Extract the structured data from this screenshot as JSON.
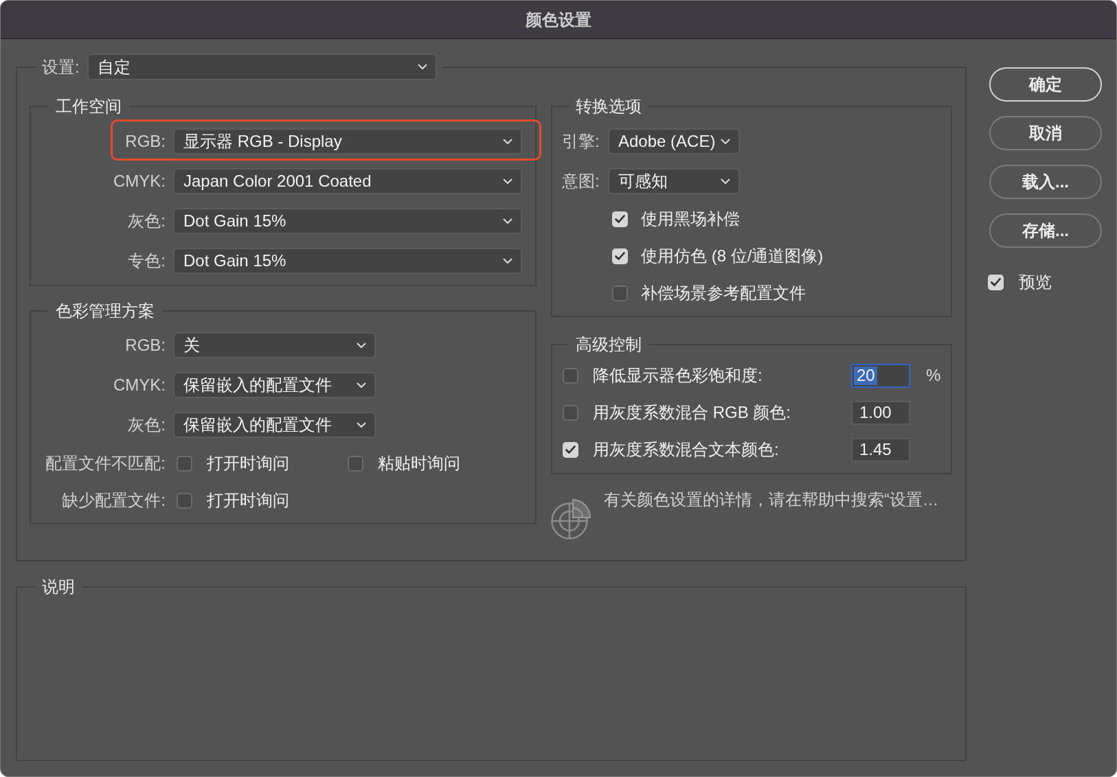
{
  "window": {
    "title": "颜色设置"
  },
  "settings": {
    "label": "设置:",
    "value": "自定"
  },
  "working_spaces": {
    "title": "工作空间",
    "rows": [
      {
        "label": "RGB:",
        "value": "显示器 RGB - Display",
        "highlighted": true
      },
      {
        "label": "CMYK:",
        "value": "Japan Color 2001 Coated",
        "highlighted": false
      },
      {
        "label": "灰色:",
        "value": "Dot Gain 15%",
        "highlighted": false
      },
      {
        "label": "专色:",
        "value": "Dot Gain 15%",
        "highlighted": false
      }
    ]
  },
  "color_management_policies": {
    "title": "色彩管理方案",
    "rows": [
      {
        "label": "RGB:",
        "value": "关"
      },
      {
        "label": "CMYK:",
        "value": "保留嵌入的配置文件"
      },
      {
        "label": "灰色:",
        "value": "保留嵌入的配置文件"
      }
    ],
    "checkbox_rows": [
      {
        "label": "配置文件不匹配:",
        "options": [
          {
            "label": "打开时询问",
            "checked": false
          },
          {
            "label": "粘贴时询问",
            "checked": false
          }
        ]
      },
      {
        "label": "缺少配置文件:",
        "options": [
          {
            "label": "打开时询问",
            "checked": false
          }
        ]
      }
    ]
  },
  "conversion_options": {
    "title": "转换选项",
    "selects": [
      {
        "label": "引擎:",
        "value": "Adobe (ACE)"
      },
      {
        "label": "意图:",
        "value": "可感知"
      }
    ],
    "options": [
      {
        "label": "使用黑场补偿",
        "checked": true
      },
      {
        "label": "使用仿色 (8 位/通道图像)",
        "checked": true
      },
      {
        "label": "补偿场景参考配置文件",
        "checked": false
      }
    ]
  },
  "advanced_controls": {
    "title": "高级控制",
    "rows": [
      {
        "label": "降低显示器色彩饱和度:",
        "checked": false,
        "value": "20",
        "unit": "%",
        "focused": true
      },
      {
        "label": "用灰度系数混合 RGB 颜色:",
        "checked": false,
        "value": "1.00",
        "focused": false
      },
      {
        "label": "用灰度系数混合文本颜色:",
        "checked": true,
        "value": "1.45",
        "focused": false
      }
    ]
  },
  "help_text": "有关颜色设置的详情，请在帮助中搜索“设置…",
  "description": {
    "title": "说明"
  },
  "buttons": [
    {
      "label": "确定",
      "default": true
    },
    {
      "label": "取消",
      "default": false
    },
    {
      "label": "载入...",
      "default": false
    },
    {
      "label": "存储...",
      "default": false
    }
  ],
  "preview": {
    "label": "预览",
    "checked": true
  }
}
